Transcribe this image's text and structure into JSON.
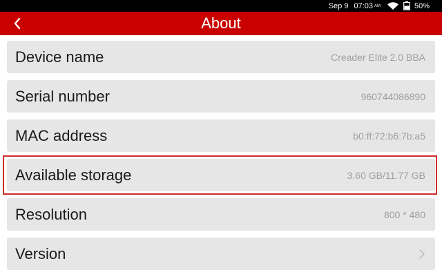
{
  "status_bar": {
    "date": "Sep 9",
    "time": "07:03",
    "ampm": "AM",
    "battery": "50%",
    "icons": [
      "wifi-icon",
      "battery-icon"
    ]
  },
  "header": {
    "title": "About",
    "back_icon": "chevron-left-icon",
    "color": "#c80000"
  },
  "rows": [
    {
      "label": "Device name",
      "value": "Creader Elite 2.0 BBA"
    },
    {
      "label": "Serial number",
      "value": "960744086890"
    },
    {
      "label": "MAC address",
      "value": "b0:ff:72:b6:7b:a5"
    },
    {
      "label": "Available storage",
      "value": "3.60 GB/11.77 GB",
      "highlighted": true
    },
    {
      "label": "Resolution",
      "value": "800 * 480"
    },
    {
      "label": "Version",
      "value": "",
      "chevron": "chevron-right-icon"
    }
  ],
  "colors": {
    "row_bg": "#e6e6e6",
    "highlight_border": "#cf2b2b",
    "value_text": "#9e9e9e"
  }
}
